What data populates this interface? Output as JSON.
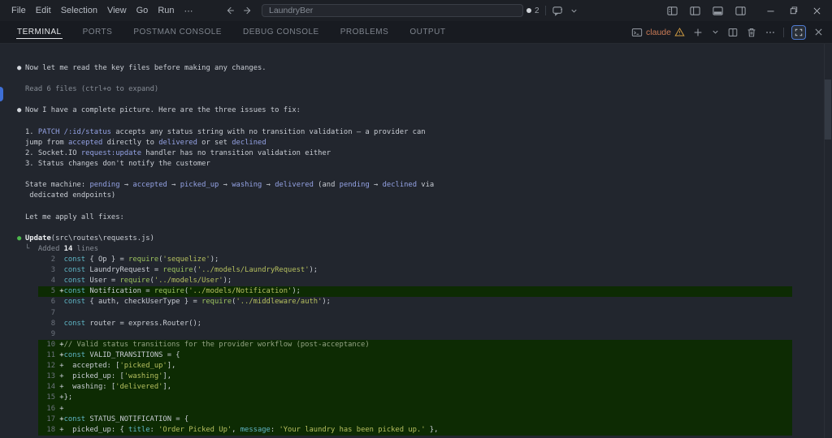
{
  "title_bar": {
    "menus": [
      "File",
      "Edit",
      "Selection",
      "View",
      "Go",
      "Run"
    ],
    "more_label": "⋯",
    "search_value": "LaundryBer",
    "badge_count": "2"
  },
  "panel_tabs": [
    "TERMINAL",
    "PORTS",
    "POSTMAN CONSOLE",
    "DEBUG CONSOLE",
    "PROBLEMS",
    "OUTPUT"
  ],
  "active_tab": "TERMINAL",
  "panel_actions": {
    "terminal_label": "claude"
  },
  "colors": {
    "accent_blue": "#94a2e4",
    "claude_label": "#c97a55",
    "warning": "#d19c43",
    "added_line_bg": "#0d2b03",
    "green_bullet": "#4cb84c",
    "active_tab_underline": "#e6e8eb",
    "focus_border": "#4f7bd0"
  },
  "terminal": {
    "lines": [
      {
        "kind": "chat",
        "bullet": "white",
        "seg": [
          [
            "Now let me read the key files before making any changes.",
            "fg"
          ]
        ]
      },
      {
        "kind": "blank",
        "seg": []
      },
      {
        "kind": "sub",
        "seg": [
          [
            "Read 6 files (ctrl+o to expand)",
            "dim"
          ]
        ]
      },
      {
        "kind": "blank",
        "seg": []
      },
      {
        "kind": "chat",
        "bullet": "white",
        "seg": [
          [
            "Now I have a complete picture. Here are the three issues to fix:",
            "fg"
          ]
        ]
      },
      {
        "kind": "blank",
        "seg": []
      },
      {
        "kind": "body",
        "seg": [
          [
            "1. ",
            "fg"
          ],
          [
            "PATCH /:id/status",
            "acc"
          ],
          [
            " accepts any status string with no transition validation — a provider can",
            "fg"
          ]
        ]
      },
      {
        "kind": "body",
        "seg": [
          [
            "jump from ",
            "fg"
          ],
          [
            "accepted",
            "acc"
          ],
          [
            " directly to ",
            "fg"
          ],
          [
            "delivered",
            "acc"
          ],
          [
            " or set ",
            "fg"
          ],
          [
            "declined",
            "acc"
          ]
        ]
      },
      {
        "kind": "body",
        "seg": [
          [
            "2. Socket.IO ",
            "fg"
          ],
          [
            "request:update",
            "acc"
          ],
          [
            " handler has no transition validation either",
            "fg"
          ]
        ]
      },
      {
        "kind": "body",
        "seg": [
          [
            "3. Status changes don't notify the customer",
            "fg"
          ]
        ]
      },
      {
        "kind": "blank",
        "seg": []
      },
      {
        "kind": "body",
        "seg": [
          [
            "State machine: ",
            "fg"
          ],
          [
            "pending",
            "acc"
          ],
          [
            " → ",
            "fg"
          ],
          [
            "accepted",
            "acc"
          ],
          [
            " → ",
            "fg"
          ],
          [
            "picked_up",
            "acc"
          ],
          [
            " → ",
            "fg"
          ],
          [
            "washing",
            "acc"
          ],
          [
            " → ",
            "fg"
          ],
          [
            "delivered",
            "acc"
          ],
          [
            " (and ",
            "fg"
          ],
          [
            "pending",
            "acc"
          ],
          [
            " → ",
            "fg"
          ],
          [
            "declined",
            "acc"
          ],
          [
            " via",
            "fg"
          ]
        ]
      },
      {
        "kind": "body",
        "seg": [
          [
            " dedicated endpoints)",
            "fg"
          ]
        ]
      },
      {
        "kind": "blank",
        "seg": []
      },
      {
        "kind": "body",
        "seg": [
          [
            "Let me apply all fixes:",
            "fg"
          ]
        ]
      },
      {
        "kind": "blank",
        "seg": []
      },
      {
        "kind": "chat",
        "bullet": "green",
        "seg": [
          [
            "Update",
            "wb"
          ],
          [
            "(src\\routes\\requests.js)",
            "fg"
          ]
        ]
      },
      {
        "kind": "sub",
        "seg": [
          [
            "└  ",
            "dim"
          ],
          [
            "Added ",
            "dim"
          ],
          [
            "14",
            "wb"
          ],
          [
            " lines",
            "dim"
          ]
        ]
      },
      {
        "kind": "code",
        "num": "2",
        "seg": [
          [
            "  ",
            "fg"
          ],
          [
            "const",
            "cyan"
          ],
          [
            " { Op } = ",
            "fg"
          ],
          [
            "require",
            "fn"
          ],
          [
            "(",
            "fg"
          ],
          [
            "'sequelize'",
            "str"
          ],
          [
            ");",
            "fg"
          ]
        ]
      },
      {
        "kind": "code",
        "num": "3",
        "seg": [
          [
            "  ",
            "fg"
          ],
          [
            "const",
            "cyan"
          ],
          [
            " LaundryRequest = ",
            "fg"
          ],
          [
            "require",
            "fn"
          ],
          [
            "(",
            "fg"
          ],
          [
            "'../models/LaundryRequest'",
            "str"
          ],
          [
            ");",
            "fg"
          ]
        ]
      },
      {
        "kind": "code",
        "num": "4",
        "seg": [
          [
            "  ",
            "fg"
          ],
          [
            "const",
            "cyan"
          ],
          [
            " User = ",
            "fg"
          ],
          [
            "require",
            "fn"
          ],
          [
            "(",
            "fg"
          ],
          [
            "'../models/User'",
            "str"
          ],
          [
            ");",
            "fg"
          ]
        ]
      },
      {
        "kind": "code",
        "num": "5",
        "added": true,
        "seg": [
          [
            " +",
            "wht"
          ],
          [
            "const",
            "cyan"
          ],
          [
            " Notification = ",
            "fg"
          ],
          [
            "require",
            "fn"
          ],
          [
            "(",
            "fg"
          ],
          [
            "'../models/Notification'",
            "str"
          ],
          [
            ");",
            "fg"
          ]
        ]
      },
      {
        "kind": "code",
        "num": "6",
        "seg": [
          [
            "  ",
            "fg"
          ],
          [
            "const",
            "cyan"
          ],
          [
            " { auth, checkUserType } = ",
            "fg"
          ],
          [
            "require",
            "fn"
          ],
          [
            "(",
            "fg"
          ],
          [
            "'../middleware/auth'",
            "str"
          ],
          [
            ");",
            "fg"
          ]
        ]
      },
      {
        "kind": "code",
        "num": "7",
        "seg": []
      },
      {
        "kind": "code",
        "num": "8",
        "seg": [
          [
            "  ",
            "fg"
          ],
          [
            "const",
            "cyan"
          ],
          [
            " router = express.Router();",
            "fg"
          ]
        ]
      },
      {
        "kind": "code",
        "num": "9",
        "seg": []
      },
      {
        "kind": "code",
        "num": "10",
        "added": true,
        "seg": [
          [
            " +",
            "wht"
          ],
          [
            "// Valid status transitions for the provider workflow (post-acceptance)",
            "cmt"
          ]
        ]
      },
      {
        "kind": "code",
        "num": "11",
        "added": true,
        "seg": [
          [
            " +",
            "wht"
          ],
          [
            "const",
            "cyan"
          ],
          [
            " VALID_TRANSITIONS = {",
            "fg"
          ]
        ]
      },
      {
        "kind": "code",
        "num": "12",
        "added": true,
        "seg": [
          [
            " +  accepted: [",
            "fg"
          ],
          [
            "'picked_up'",
            "str"
          ],
          [
            "],",
            "fg"
          ]
        ]
      },
      {
        "kind": "code",
        "num": "13",
        "added": true,
        "seg": [
          [
            " +  picked_up: [",
            "fg"
          ],
          [
            "'washing'",
            "str"
          ],
          [
            "],",
            "fg"
          ]
        ]
      },
      {
        "kind": "code",
        "num": "14",
        "added": true,
        "seg": [
          [
            " +  washing: [",
            "fg"
          ],
          [
            "'delivered'",
            "str"
          ],
          [
            "],",
            "fg"
          ]
        ]
      },
      {
        "kind": "code",
        "num": "15",
        "added": true,
        "seg": [
          [
            " +};",
            "fg"
          ]
        ]
      },
      {
        "kind": "code",
        "num": "16",
        "added": true,
        "seg": [
          [
            " +",
            "fg"
          ]
        ]
      },
      {
        "kind": "code",
        "num": "17",
        "added": true,
        "seg": [
          [
            " +",
            "wht"
          ],
          [
            "const",
            "cyan"
          ],
          [
            " STATUS_NOTIFICATION = {",
            "fg"
          ]
        ]
      },
      {
        "kind": "code",
        "num": "18",
        "added": true,
        "seg": [
          [
            " +  picked_up: { ",
            "fg"
          ],
          [
            "title",
            "cyan"
          ],
          [
            ": ",
            "fg"
          ],
          [
            "'Order Picked Up'",
            "str"
          ],
          [
            ", ",
            "fg"
          ],
          [
            "message",
            "cyan"
          ],
          [
            ": ",
            "fg"
          ],
          [
            "'Your laundry has been picked up.'",
            "str"
          ],
          [
            " },",
            "fg"
          ]
        ]
      }
    ]
  }
}
